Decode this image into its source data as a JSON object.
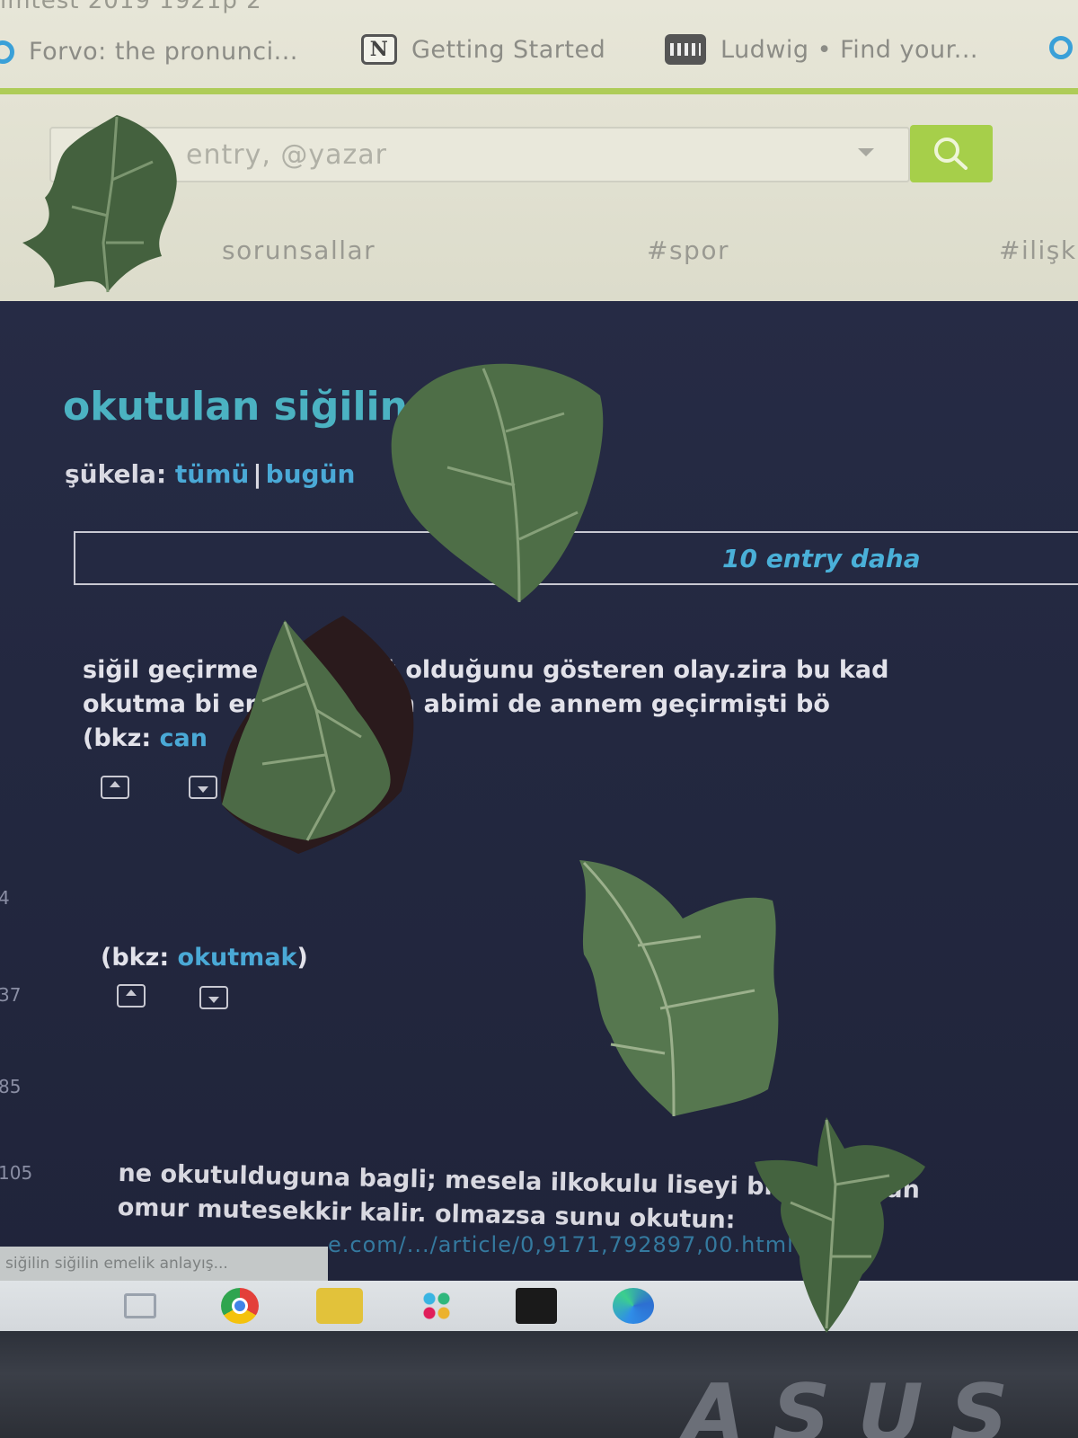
{
  "window": {
    "title_fragment": "imtest   2019 1921p   2"
  },
  "bookmarks": [
    {
      "label": "Forvo: the pronunci...",
      "icon": "forvo-circle-icon"
    },
    {
      "label": "Getting Started",
      "icon": "notion-icon"
    },
    {
      "label": "Ludwig • Find your...",
      "icon": "typewriter-icon"
    }
  ],
  "search": {
    "placeholder": "entry, @yazar"
  },
  "nav_tabs": [
    "sorunsallar",
    "#spor",
    "#ilişk"
  ],
  "page": {
    "title": "okutulan siğilin ... esi",
    "sukela_label": "şükela:",
    "sukela_all": "tümü",
    "sukela_sep": "|",
    "sukela_today": "bugün",
    "more_entries": "10 entry daha"
  },
  "entries": [
    {
      "line1": "siğil geçirme        nsic büyü olduğunu gösteren olay.zira bu kad",
      "line2": "okutma bi              emiştir.benim abimi de annem geçirmişti bö",
      "bkz_prefix": "(bkz: ",
      "bkz_link": "can"
    },
    {
      "bkz_prefix": "(bkz: ",
      "bkz_link": "okutmak",
      "bkz_suffix": ")"
    },
    {
      "line1": "ne okutulduguna bagli; mesela ilkokulu liseyi bi                okutursan",
      "line2": "omur mutesekkir kalir. olmazsa sunu okutun:"
    }
  ],
  "side_numbers": [
    "4",
    "37",
    "85",
    "105"
  ],
  "url_fragment": "e.com/.../article/0,9171,792897,00.html",
  "taskbar_tooltip": "siğilin siğilin emelik anlayış...",
  "taskbar_icons": [
    "task-view-icon",
    "chrome-icon",
    "todo-icon",
    "slack-icon",
    "figma-icon",
    "edge-icon"
  ],
  "bezel_logo": "ASUS",
  "colors": {
    "accent_green": "#a6cf4a",
    "title_teal": "#4bb2c2",
    "link_blue": "#4aa9d6",
    "leaf_green": "#4a6b44"
  }
}
